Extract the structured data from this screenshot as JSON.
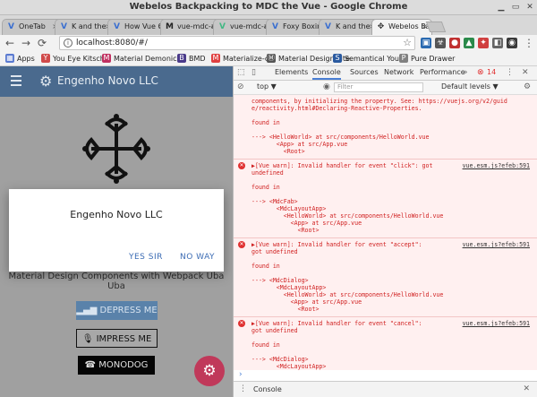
{
  "window": {
    "title": "Webelos Backpacking to MDC the Vue - Google Chrome",
    "minimize_icon": "minimize-icon",
    "maximize_icon": "maximize-icon",
    "close_icon": "close-icon"
  },
  "tabs": [
    {
      "label": "OneTab",
      "icon": "V",
      "color": "#3a6fd0",
      "active": false
    },
    {
      "label": "K and the S",
      "icon": "V",
      "color": "#3a6fd0",
      "active": false
    },
    {
      "label": "How Vue Cli",
      "icon": "V",
      "color": "#3a6fd0",
      "active": false
    },
    {
      "label": "vue-mdc-ad",
      "icon": "M",
      "color": "#222222",
      "active": false
    },
    {
      "label": "vue-mdc-ad",
      "icon": "V",
      "color": "#41b883",
      "active": false
    },
    {
      "label": "Foxy Boxing",
      "icon": "V",
      "color": "#3a6fd0",
      "active": false
    },
    {
      "label": "K and the S",
      "icon": "V",
      "color": "#3a6fd0",
      "active": false
    },
    {
      "label": "Webelos Ba",
      "icon": "✥",
      "color": "#333333",
      "active": true
    }
  ],
  "toolbar": {
    "url": "localhost:8080/#/",
    "back": "←",
    "forward": "→",
    "reload": "C"
  },
  "bookmarks": [
    {
      "label": "Apps",
      "icon": "▦",
      "color": "#5a7ad0"
    },
    {
      "label": "You Eye Kitsch",
      "icon": "Y",
      "color": "#d04a4a"
    },
    {
      "label": "Material Demonics",
      "icon": "M",
      "color": "#c03060"
    },
    {
      "label": "BMD",
      "icon": "B",
      "color": "#4a3a8a"
    },
    {
      "label": "Materialize-o",
      "icon": "M",
      "color": "#e04040"
    },
    {
      "label": "Material Design Lite",
      "icon": "Ⓜ",
      "color": "#555555"
    },
    {
      "label": "Semantical You",
      "icon": "S",
      "color": "#2a5aa0"
    },
    {
      "label": "Pure Drawer",
      "icon": "P",
      "color": "#808080"
    }
  ],
  "app": {
    "title": "Engenho Novo LLC",
    "subtitle": "Material Design Components with Webpack Uba Uba",
    "depress_label": "DEPRESS ME",
    "impress_label": "IMPRESS ME",
    "monodog_label": "MONODOG",
    "dialog": {
      "title": "Engenho Novo LLC",
      "accept_label": "YES SIR",
      "cancel_label": "NO WAY"
    }
  },
  "devtools": {
    "tabs": [
      "Elements",
      "Console",
      "Sources",
      "Network",
      "Performance"
    ],
    "active_tab": "Console",
    "error_count": "14",
    "context": "top",
    "filter_placeholder": "Filter",
    "levels": "Default levels ▼",
    "drawer_tab": "Console",
    "messages": [
      {
        "icon": false,
        "source": "",
        "lines": [
          "components, by initializing the property. See: https://vuejs.org/v2/guid",
          "e/reactivity.html#Declaring-Reactive-Properties.",
          "",
          "found in",
          "",
          "---> <HelloWorld> at src/components/HelloWorld.vue",
          "       <App> at src/App.vue",
          "         <Root>"
        ]
      },
      {
        "icon": true,
        "source": "vue.esm.js?efeb:591",
        "lines": [
          "▶[Vue warn]: Invalid handler for event \"click\": got",
          "undefined",
          "",
          "found in",
          "",
          "---> <MdcFab>",
          "       <MdcLayoutApp>",
          "         <HelloWorld> at src/components/HelloWorld.vue",
          "           <App> at src/App.vue",
          "             <Root>"
        ]
      },
      {
        "icon": true,
        "source": "vue.esm.js?efeb:591",
        "lines": [
          "▶[Vue warn]: Invalid handler for event \"accept\":",
          "got undefined",
          "",
          "found in",
          "",
          "---> <MdcDialog>",
          "       <MdcLayoutApp>",
          "         <HelloWorld> at src/components/HelloWorld.vue",
          "           <App> at src/App.vue",
          "             <Root>"
        ]
      },
      {
        "icon": true,
        "source": "vue.esm.js?efeb:591",
        "lines": [
          "▶[Vue warn]: Invalid handler for event \"cancel\":",
          "got undefined",
          "",
          "found in",
          "",
          "---> <MdcDialog>",
          "       <MdcLayoutApp>",
          "         <HelloWorld> at src/components/HelloWorld.vue",
          "           <App> at src/App.vue",
          "             <Root>"
        ]
      }
    ]
  }
}
